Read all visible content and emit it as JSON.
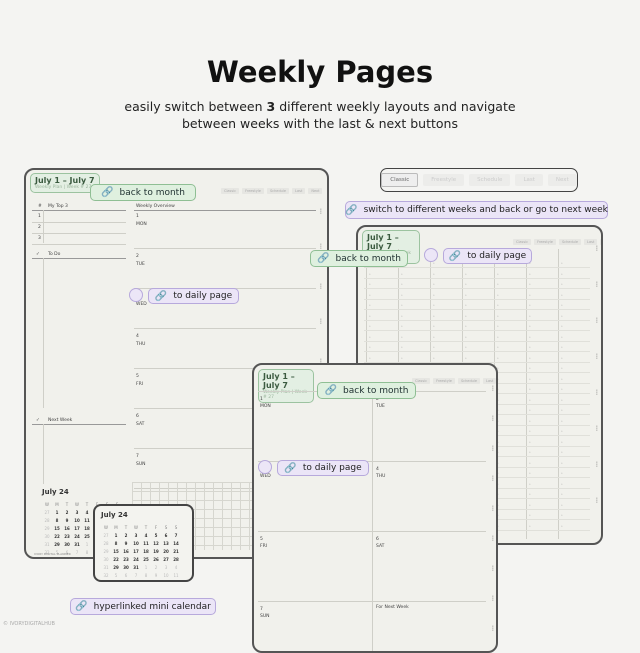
{
  "title": "Weekly Pages",
  "subtitle": {
    "pre": "easily switch between ",
    "bold": "3",
    "post": " different weekly layouts and navigate",
    "line2": "between weeks with the last & next buttons"
  },
  "header": {
    "range": "July 1 – July 7",
    "plan": "Weekly Plan | Week # 27"
  },
  "toolbar": {
    "buttons": [
      "Classic",
      "Freestyle",
      "Schedule",
      "Last",
      "Next"
    ],
    "active": "Classic"
  },
  "callouts": {
    "back_to_month": "back to month",
    "to_daily_page": "to daily page",
    "switch_weeks": "switch to different weeks and back or go to next week",
    "mini_calendar": "hyperlinked mini calendar"
  },
  "classic": {
    "top3_hash": "#",
    "top3_label": "My Top 3",
    "top3": [
      "1",
      "2",
      "3"
    ],
    "overview": "Weekly Overview",
    "todo_check": "✓",
    "todo": "To Do",
    "next_week": "Next Week",
    "footer": "IVORY DIGITAL PLANNER"
  },
  "days": [
    {
      "n": "1",
      "d": "MON"
    },
    {
      "n": "2",
      "d": "TUE"
    },
    {
      "n": "3",
      "d": "WED"
    },
    {
      "n": "4",
      "d": "THU"
    },
    {
      "n": "5",
      "d": "FRI"
    },
    {
      "n": "6",
      "d": "SAT"
    },
    {
      "n": "7",
      "d": "SUN"
    }
  ],
  "freestyle": {
    "next_week": "For Next Week"
  },
  "calendar": {
    "title": "July 24",
    "weekdays": [
      "W",
      "M",
      "T",
      "W",
      "T",
      "F",
      "S",
      "S"
    ],
    "rows": [
      [
        "27",
        "1",
        "2",
        "3",
        "4",
        "5",
        "6",
        "7"
      ],
      [
        "28",
        "8",
        "9",
        "10",
        "11",
        "12",
        "13",
        "14"
      ],
      [
        "29",
        "15",
        "16",
        "17",
        "18",
        "19",
        "20",
        "21"
      ],
      [
        "30",
        "22",
        "23",
        "24",
        "25",
        "26",
        "27",
        "28"
      ],
      [
        "31",
        "29",
        "30",
        "31",
        "1",
        "2",
        "3",
        "4"
      ],
      [
        "32",
        "5",
        "6",
        "7",
        "8",
        "9",
        "10",
        "11"
      ]
    ]
  },
  "copyright": "© IVORYDIGITALHUB",
  "icons": {
    "link": "link-icon",
    "more": "vertical-dots-icon"
  },
  "colors": {
    "green": "#dff0df",
    "purple": "#ebe5f7",
    "border": "#555555"
  }
}
